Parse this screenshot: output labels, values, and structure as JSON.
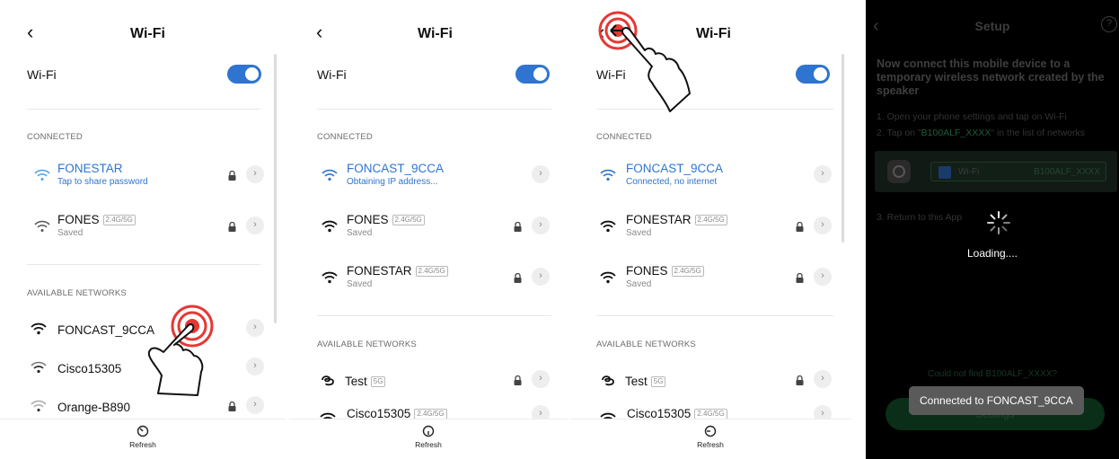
{
  "panels": [
    {
      "title": "Wi-Fi",
      "wifi_label": "Wi-Fi",
      "connected_header": "CONNECTED",
      "connected": [
        {
          "name": "FONESTAR",
          "sub": "Tap to share password",
          "badge": ""
        },
        {
          "name": "FONES",
          "sub": "Saved",
          "badge": "2.4G/5G"
        }
      ],
      "available_header": "AVAILABLE NETWORKS",
      "available": [
        {
          "name": "FONCAST_9CCA",
          "badge": ""
        },
        {
          "name": "Cisco15305",
          "badge": ""
        },
        {
          "name": "Orange-B890",
          "badge": ""
        }
      ],
      "refresh": "Refresh"
    },
    {
      "title": "Wi-Fi",
      "wifi_label": "Wi-Fi",
      "connected_header": "CONNECTED",
      "connected": [
        {
          "name": "FONCAST_9CCA",
          "sub": "Obtaining IP address...",
          "badge": ""
        },
        {
          "name": "FONES",
          "sub": "Saved",
          "badge": "2.4G/5G"
        },
        {
          "name": "FONESTAR",
          "sub": "Saved",
          "badge": "2.4G/5G"
        }
      ],
      "available_header": "AVAILABLE NETWORKS",
      "available": [
        {
          "name": "Test",
          "badge": "5G"
        },
        {
          "name": "Cisco15305",
          "badge": "2.4G/5G"
        }
      ],
      "refresh": "Refresh"
    },
    {
      "title": "Wi-Fi",
      "wifi_label": "Wi-Fi",
      "connected_header": "CONNECTED",
      "connected": [
        {
          "name": "FONCAST_9CCA",
          "sub": "Connected, no internet",
          "badge": ""
        },
        {
          "name": "FONESTAR",
          "sub": "Saved",
          "badge": "2.4G/5G"
        },
        {
          "name": "FONES",
          "sub": "Saved",
          "badge": "2.4G/5G"
        }
      ],
      "available_header": "AVAILABLE NETWORKS",
      "available": [
        {
          "name": "Test",
          "badge": "5G"
        },
        {
          "name": "Cisco15305",
          "badge": "2.4G/5G"
        }
      ],
      "refresh": "Refresh"
    }
  ],
  "setup": {
    "title": "Setup",
    "help": "?",
    "heading": "Now connect this mobile device to a temporary wireless network created by the speaker",
    "step1": "1. Open your phone settings and tap on Wi-Fi",
    "step2_prefix": "2. Tap on \"",
    "step2_network": "B100ALF_XXXX",
    "step2_suffix": "\" in the list of networks",
    "illus_wifi": "Wi-Fi",
    "illus_network": "B100ALF_XXXX",
    "step3": "3. Return to this App",
    "loading": "Loading....",
    "not_found": "Could not find B100ALF_XXXX?",
    "settings_button": "Settings",
    "toast": "Connected to FONCAST_9CCA"
  },
  "colors": {
    "accent": "#2f74d0",
    "toast_bg": "#5a5a5a",
    "hand_tap": "#e53935"
  }
}
